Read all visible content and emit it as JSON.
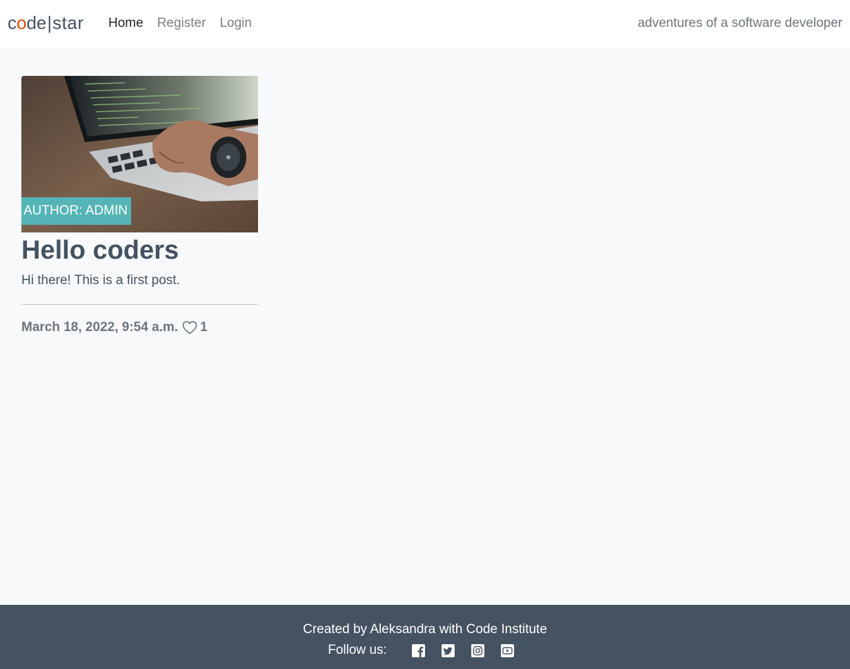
{
  "nav": {
    "brand_code_c": "c",
    "brand_code_o": "o",
    "brand_code_de": "de",
    "brand_sep": "|",
    "brand_star": "star",
    "links": [
      {
        "label": "Home",
        "active": true
      },
      {
        "label": "Register",
        "active": false
      },
      {
        "label": "Login",
        "active": false
      }
    ],
    "tagline": "adventures of a software developer"
  },
  "post": {
    "author_badge": "AUTHOR: ADMIN",
    "title": "Hello coders",
    "excerpt": "Hi there! This is a first post.",
    "date": "March 18, 2022, 9:54 a.m.",
    "likes": "1"
  },
  "footer": {
    "credit": "Created by Aleksandra with Code Institute",
    "follow_label": "Follow us:",
    "social_icons": [
      "facebook-icon",
      "twitter-icon",
      "instagram-icon",
      "youtube-icon"
    ]
  },
  "colors": {
    "brand_accent": "#e84610",
    "badge": "#55b4b5",
    "footer_bg": "#445261",
    "page_bg": "#f8f9fa"
  }
}
